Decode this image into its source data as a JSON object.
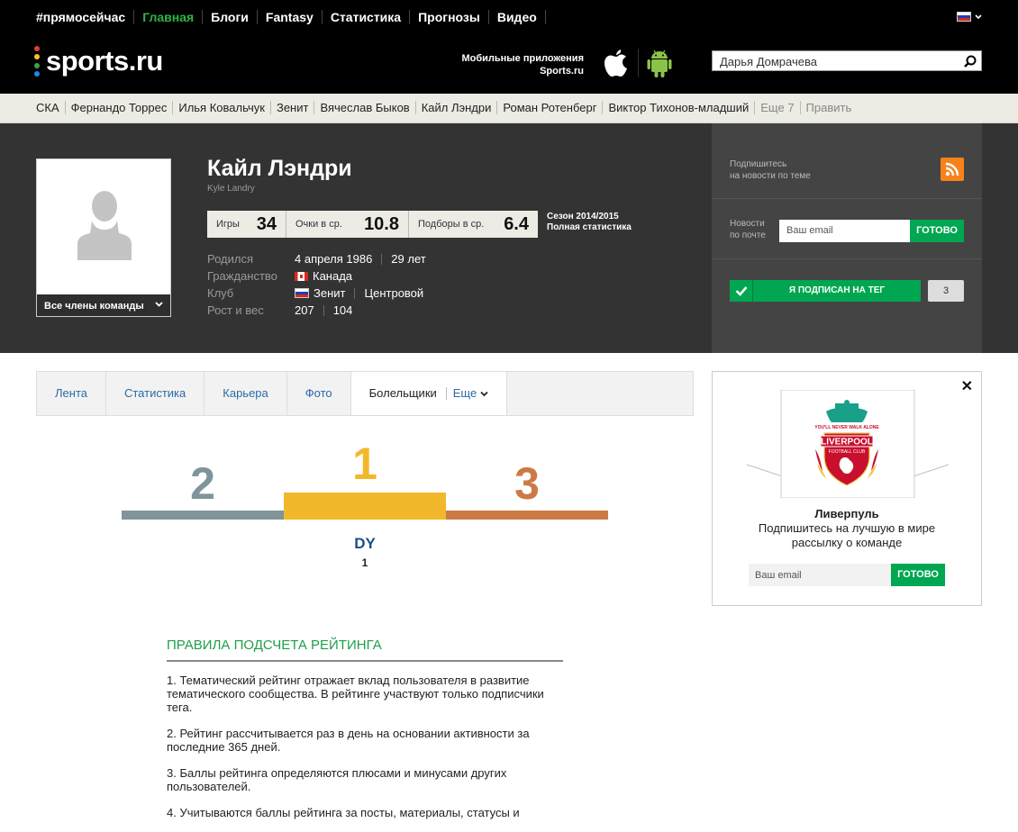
{
  "topnav": {
    "items": [
      "#прямосейчас",
      "Главная",
      "Блоги",
      "Fantasy",
      "Статистика",
      "Прогнозы",
      "Видео"
    ],
    "active_index": 1
  },
  "header": {
    "logo_text": "sports.ru",
    "apps_line1": "Мобильные приложения",
    "apps_line2": "Sports.ru",
    "search_value": "Дарья Домрачева"
  },
  "tagbar": {
    "tags": [
      "СКА",
      "Фернандо Торрес",
      "Илья Ковальчук",
      "Зенит",
      "Вячеслав Быков",
      "Кайл Лэндри",
      "Роман Ротенберг",
      "Виктор Тихонов-младший"
    ],
    "more": "Еще 7",
    "edit": "Править"
  },
  "profile": {
    "name": "Кайл Лэндри",
    "name_latin": "Kyle Landry",
    "team_members_label": "Все члены команды",
    "stats": [
      {
        "label": "Игры",
        "value": "34"
      },
      {
        "label": "Очки в ср.",
        "value": "10.8"
      },
      {
        "label": "Подборы в ср.",
        "value": "6.4"
      }
    ],
    "season_line1": "Сезон 2014/2015",
    "season_line2": "Полная статистика",
    "facts": {
      "born_label": "Родился",
      "born_date": "4 апреля 1986",
      "born_age": "29 лет",
      "citizenship_label": "Гражданство",
      "citizenship": "Канада",
      "club_label": "Клуб",
      "club": "Зенит",
      "position": "Центровой",
      "height_weight_label": "Рост и вес",
      "height": "207",
      "weight": "104"
    }
  },
  "subscribe": {
    "news_line1": "Подпишитесь",
    "news_line2": "на новости по теме",
    "mail_line1": "Новости",
    "mail_line2": "по почте",
    "email_placeholder": "Ваш email",
    "submit": "ГОТОВО",
    "subscribed_label": "Я ПОДПИСАН НА ТЕГ",
    "subscribed_count": "3"
  },
  "tabs": {
    "items": [
      "Лента",
      "Статистика",
      "Карьера",
      "Фото"
    ],
    "active": "Болельщики",
    "more": "Еще"
  },
  "podium": {
    "second": "2",
    "first": "1",
    "third": "3",
    "winner_name": "DY",
    "winner_score": "1",
    "colors": {
      "first": "#f2b82b",
      "second": "#7f949b",
      "third": "#cc7a45"
    }
  },
  "rules": {
    "title": "ПРАВИЛА ПОДСЧЕТА РЕЙТИНГА",
    "p1": "1. Тематический рейтинг отражает вклад пользователя в развитие тематического сообщества. В рейтинге участвуют только подписчики тега.",
    "p2": "2. Рейтинг рассчитывается раз в день на основании активности за последние 365 дней.",
    "p3": "3. Баллы рейтинга определяются плюсами и минусами других пользователей.",
    "p4": "4. Учитываются баллы рейтинга за посты, материалы, статусы и"
  },
  "ad": {
    "close": "✕",
    "team": "Ливерпуль",
    "subtitle": "Подпишитесь на лучшую в мире рассылку о команде",
    "email_placeholder": "Ваш email",
    "submit": "ГОТОВО",
    "crest_top_text": "YOU'LL NEVER WALK ALONE",
    "crest_name": "LIVERPOOL",
    "crest_sub": "FOOTBALL CLUB"
  }
}
